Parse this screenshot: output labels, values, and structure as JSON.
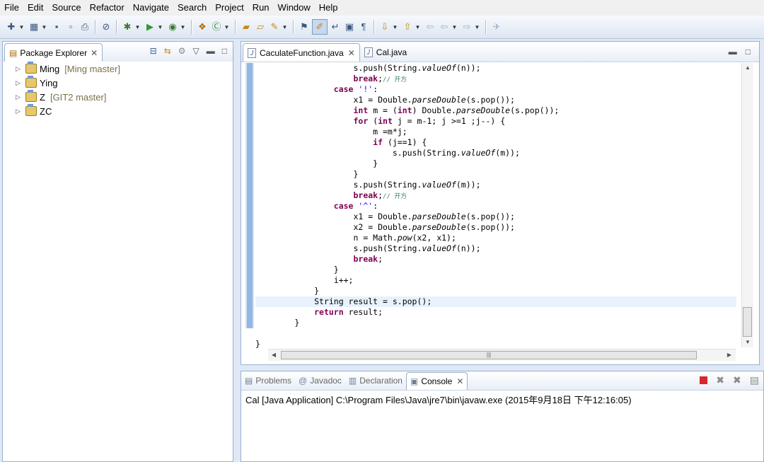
{
  "menu": [
    "File",
    "Edit",
    "Source",
    "Refactor",
    "Navigate",
    "Search",
    "Project",
    "Run",
    "Window",
    "Help"
  ],
  "toolbar": {
    "icons": [
      "new-icon",
      "save-icon",
      "save-all-icon",
      "print-icon",
      "skip-breakpoints-icon",
      "debug-icon",
      "run-icon",
      "external-tools-icon",
      "new-java-project-icon",
      "new-class-icon",
      "open-type-icon",
      "open-folder-icon",
      "search-icon",
      "open-task-icon",
      "toggle-mark-occurrences-icon",
      "word-wrap-icon",
      "block-selection-icon",
      "show-whitespace-icon",
      "next-annotation-icon",
      "previous-annotation-icon",
      "last-edit-icon",
      "back-icon",
      "forward-icon",
      "pin-editor-icon"
    ]
  },
  "explorer": {
    "title": "Package Explorer",
    "projects": [
      {
        "name": "Ming",
        "repo": "[Ming master]"
      },
      {
        "name": "Ying",
        "repo": ""
      },
      {
        "name": "Z",
        "repo": "[GIT2 master]"
      },
      {
        "name": "ZC",
        "repo": ""
      }
    ]
  },
  "editor": {
    "tabs": [
      {
        "label": "CaculateFunction.java",
        "active": true
      },
      {
        "label": "Cal.java",
        "active": false
      }
    ],
    "code": [
      "                    s.push(String.valueOf(n));",
      "                    break;// 开方",
      "                case '!':",
      "                    x1 = Double.parseDouble(s.pop());",
      "                    int m = (int) Double.parseDouble(s.pop());",
      "                    for (int j = m-1; j >=1 ;j--) {",
      "                        m =m*j;",
      "                        if (j==1) {",
      "                            s.push(String.valueOf(m));",
      "                        }",
      "                    }",
      "                    s.push(String.valueOf(m));",
      "                    break;// 开方",
      "                case '^':",
      "                    x1 = Double.parseDouble(s.pop());",
      "                    x2 = Double.parseDouble(s.pop());",
      "                    n = Math.pow(x2, x1);",
      "                    s.push(String.valueOf(n));",
      "                    break;",
      "                }",
      "                i++;",
      "            }",
      "            String result = s.pop();",
      "            return result;",
      "        }",
      "",
      "}"
    ],
    "highlight_line": 22
  },
  "console": {
    "tabs": [
      {
        "label": "Problems",
        "icon": "problems-icon",
        "glyph": "▤"
      },
      {
        "label": "Javadoc",
        "icon": "javadoc-icon",
        "glyph": "@"
      },
      {
        "label": "Declaration",
        "icon": "declaration-icon",
        "glyph": "▥"
      },
      {
        "label": "Console",
        "icon": "console-icon",
        "glyph": "▣",
        "active": true
      }
    ],
    "status": "Cal [Java Application] C:\\Program Files\\Java\\jre7\\bin\\javaw.exe (2015年9月18日 下午12:16:05)"
  }
}
